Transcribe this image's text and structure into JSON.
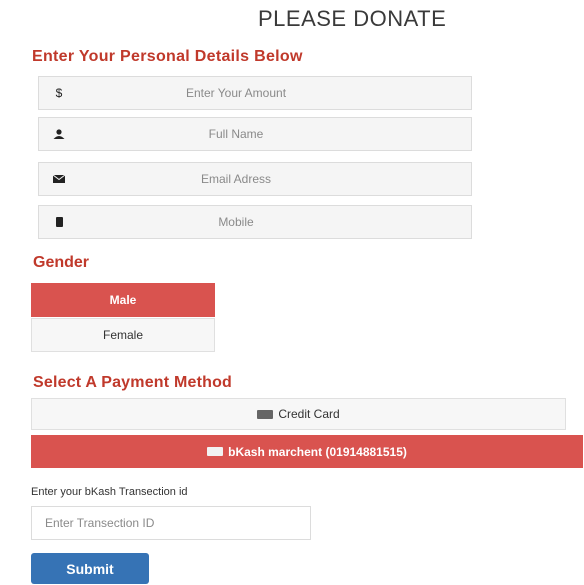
{
  "page": {
    "title": "PLEASE DONATE"
  },
  "details": {
    "heading": "Enter Your Personal Details Below",
    "fields": [
      {
        "icon": "dollar-icon",
        "glyph": "$",
        "placeholder": "Enter Your Amount"
      },
      {
        "icon": "user-icon",
        "glyph": "👤",
        "placeholder": "Full Name"
      },
      {
        "icon": "envelope-icon",
        "glyph": "✉",
        "placeholder": "Email Adress"
      },
      {
        "icon": "phone-icon",
        "glyph": "▮",
        "placeholder": "Mobile"
      }
    ]
  },
  "gender": {
    "heading": "Gender",
    "options": [
      {
        "label": "Male",
        "selected": true
      },
      {
        "label": "Female",
        "selected": false
      }
    ]
  },
  "payment": {
    "heading": "Select A Payment Method",
    "options": [
      {
        "label": "Credit Card",
        "icon": "credit-card-icon",
        "selected": false
      },
      {
        "label": "bKash marchent (01914881515)",
        "icon": "wallet-icon",
        "selected": true
      }
    ]
  },
  "transaction": {
    "label": "Enter your bKash Transection id",
    "placeholder": "Enter Transection ID"
  },
  "submit_label": "Submit",
  "colors": {
    "accent": "#d9534f",
    "heading": "#c0392b",
    "primary_button": "#3673b5"
  }
}
